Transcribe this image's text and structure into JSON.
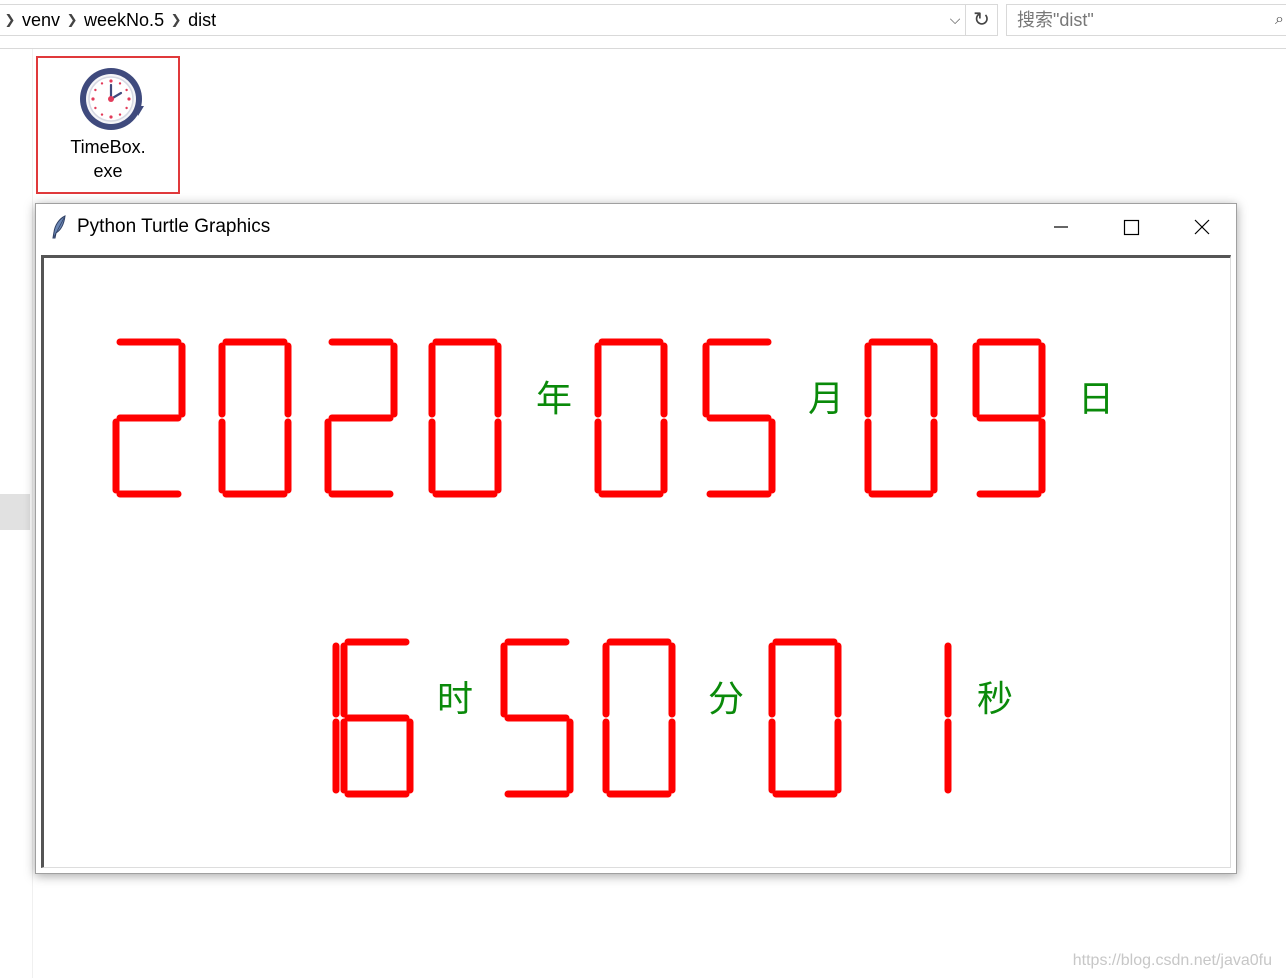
{
  "explorer": {
    "breadcrumb": [
      "venv",
      "weekNo.5",
      "dist"
    ],
    "search_placeholder": "搜索\"dist\"",
    "file_name": "TimeBox.exe",
    "file_icon": "clock-icon"
  },
  "window": {
    "title": "Python Turtle Graphics",
    "title_icon": "feather-icon",
    "controls": [
      "minimize-icon",
      "maximize-icon",
      "close-icon"
    ]
  },
  "clock": {
    "digit_color": "#ff0000",
    "label_color": "#0a8a0a",
    "date": {
      "year": "2020",
      "year_label": "年",
      "month": "05",
      "month_label": "月",
      "day": "09",
      "day_label": "日"
    },
    "time": {
      "hour": "16",
      "hour_label": "时",
      "minute": "50",
      "minute_label": "分",
      "second": "01",
      "second_label": "秒"
    }
  },
  "watermark": "https://blog.csdn.net/java0fu"
}
